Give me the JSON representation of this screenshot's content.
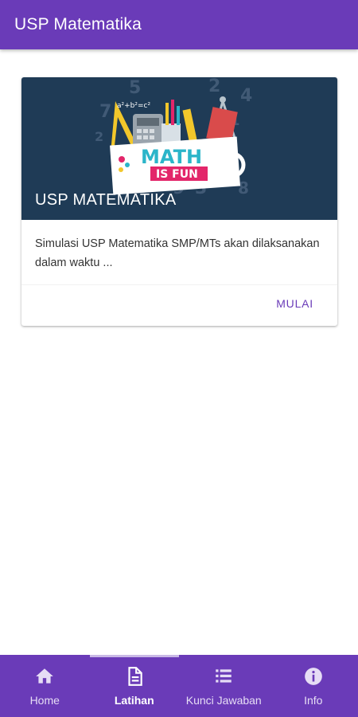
{
  "appbar": {
    "title": "USP Matematika"
  },
  "card": {
    "banner": {
      "math_text": "MATH",
      "fun_text": "IS FUN",
      "formula": "a²+b²=c²"
    },
    "title": "USP MATEMATIKA",
    "body": "Simulasi USP Matematika SMP/MTs akan dilaksanakan dalam waktu ...",
    "action_label": "MULAI"
  },
  "bottom_nav": {
    "selected": "Latihan",
    "items": [
      {
        "label": "Home",
        "icon": "home-icon"
      },
      {
        "label": "Latihan",
        "icon": "document-icon"
      },
      {
        "label": "Kunci Jawaban",
        "icon": "list-icon"
      },
      {
        "label": "Info",
        "icon": "info-icon"
      }
    ]
  },
  "colors": {
    "primary": "#6a3bb8",
    "banner_bg": "#1f3b56",
    "math_text": "#2bb5c9",
    "fun_bg": "#e3266a"
  }
}
